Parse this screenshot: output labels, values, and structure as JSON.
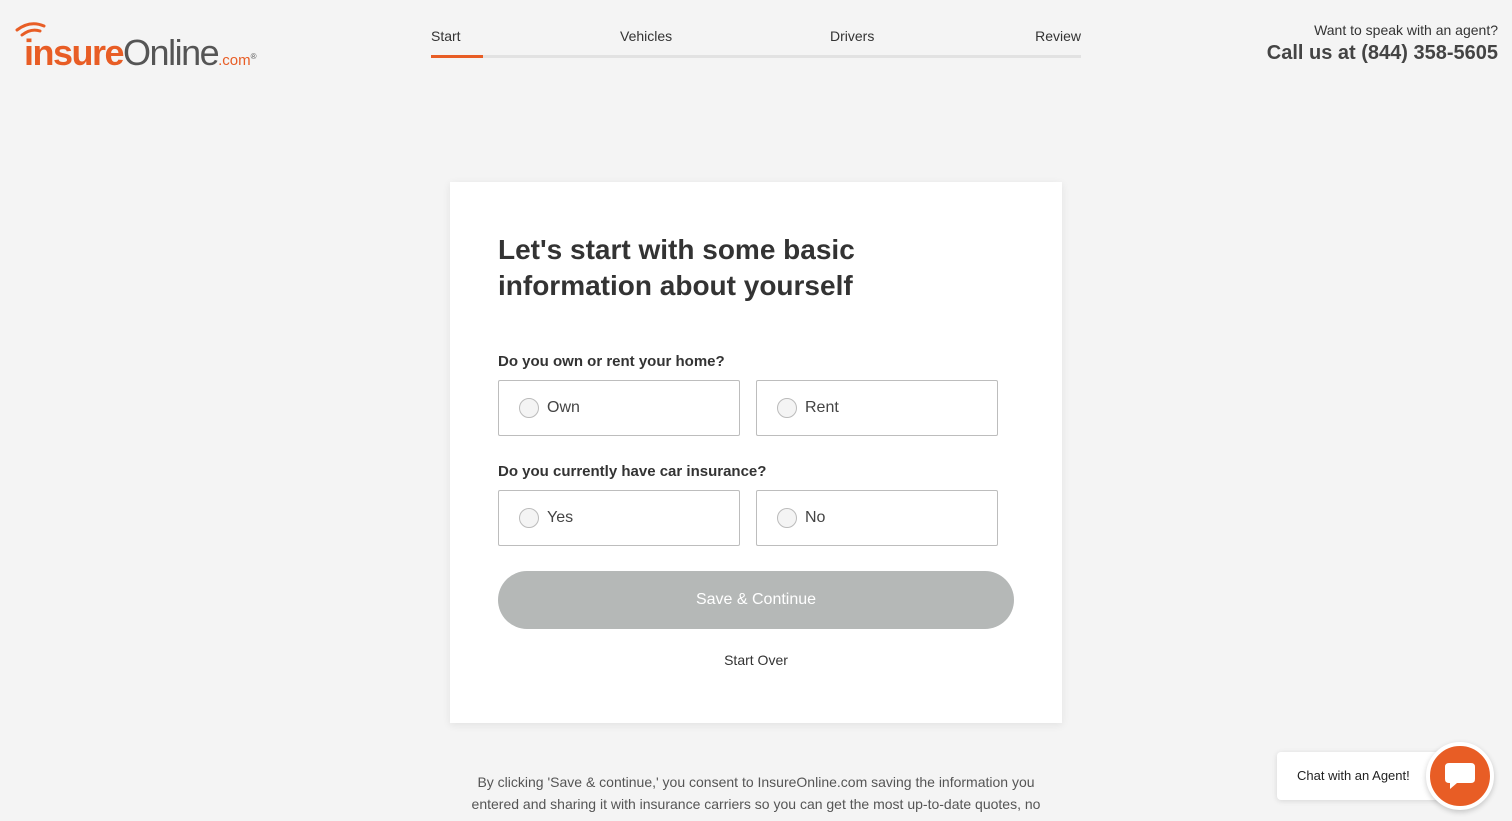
{
  "logo": {
    "insure": "insure",
    "online": "Online",
    "dotcom": ".com",
    "reg": "®"
  },
  "steps": [
    {
      "label": "Start",
      "active": true
    },
    {
      "label": "Vehicles",
      "active": false
    },
    {
      "label": "Drivers",
      "active": false
    },
    {
      "label": "Review",
      "active": false
    }
  ],
  "agent": {
    "question": "Want to speak with an agent?",
    "call": "Call us at (844) 358-5605"
  },
  "form": {
    "title": "Let's start with some basic information about yourself",
    "q1": {
      "label": "Do you own or rent your home?",
      "options": [
        "Own",
        "Rent"
      ]
    },
    "q2": {
      "label": "Do you currently have car insurance?",
      "options": [
        "Yes",
        "No"
      ]
    },
    "save_label": "Save & Continue",
    "start_over_label": "Start Over"
  },
  "disclaimer": "By clicking 'Save & continue,' you consent to InsureOnline.com saving the information you entered and sharing it with insurance carriers so you can get the most up-to-date quotes, no",
  "chat": {
    "label": "Chat with an Agent!",
    "icon": "chat-bubble-icon"
  },
  "colors": {
    "accent": "#e85d25",
    "button_disabled": "#b5b8b7",
    "background": "#f4f4f4"
  }
}
